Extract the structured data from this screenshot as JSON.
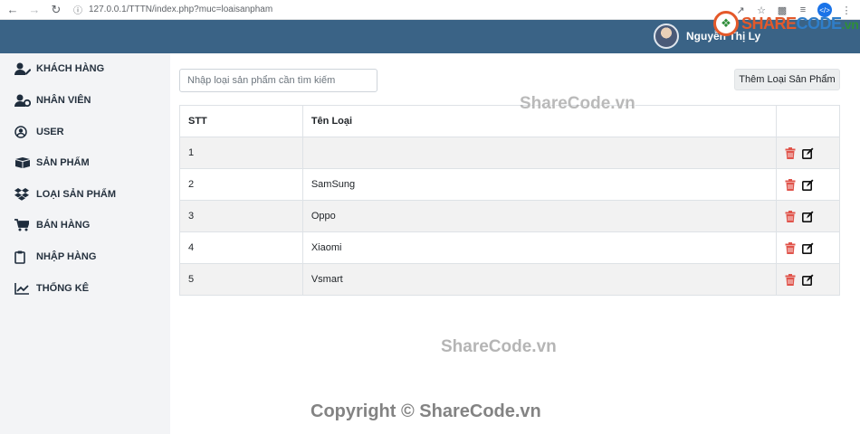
{
  "browser": {
    "url": "127.0.0.1/TTTN/index.php?muc=loaisanpham"
  },
  "header": {
    "user_name": "Nguyễn Thị Ly"
  },
  "brand": {
    "logo_share": "SHARE",
    "logo_code": "CODE",
    "logo_vn": ".vn"
  },
  "sidebar": {
    "items": [
      {
        "label": "KHÁCH HÀNG",
        "icon": "user-edit-icon"
      },
      {
        "label": "NHÂN VIÊN",
        "icon": "user-cog-icon"
      },
      {
        "label": "USER",
        "icon": "user-circle-icon"
      },
      {
        "label": "SẢN PHẨM",
        "icon": "boxes-icon"
      },
      {
        "label": "LOẠI SẢN PHẨM",
        "icon": "dropbox-icon"
      },
      {
        "label": "BÁN HÀNG",
        "icon": "cart-icon"
      },
      {
        "label": "NHẬP HÀNG",
        "icon": "clipboard-icon"
      },
      {
        "label": "THỐNG KÊ",
        "icon": "chart-line-icon"
      }
    ]
  },
  "main": {
    "search_placeholder": "Nhập loại sản phẩm cần tìm kiếm",
    "add_button": "Thêm Loại Sản Phẩm",
    "table": {
      "headers": [
        "STT",
        "Tên Loại",
        ""
      ],
      "rows": [
        {
          "stt": "1",
          "name": ""
        },
        {
          "stt": "2",
          "name": "SamSung"
        },
        {
          "stt": "3",
          "name": "Oppo"
        },
        {
          "stt": "4",
          "name": "Xiaomi"
        },
        {
          "stt": "5",
          "name": "Vsmart"
        }
      ]
    }
  },
  "watermarks": {
    "wm1": "ShareCode.vn",
    "wm2": "ShareCode.vn",
    "wm3": "Copyright © ShareCode.vn"
  },
  "colors": {
    "header_bg": "#3a6386",
    "delete_icon": "#e0544b",
    "sidebar_bg": "#f3f4f6"
  }
}
